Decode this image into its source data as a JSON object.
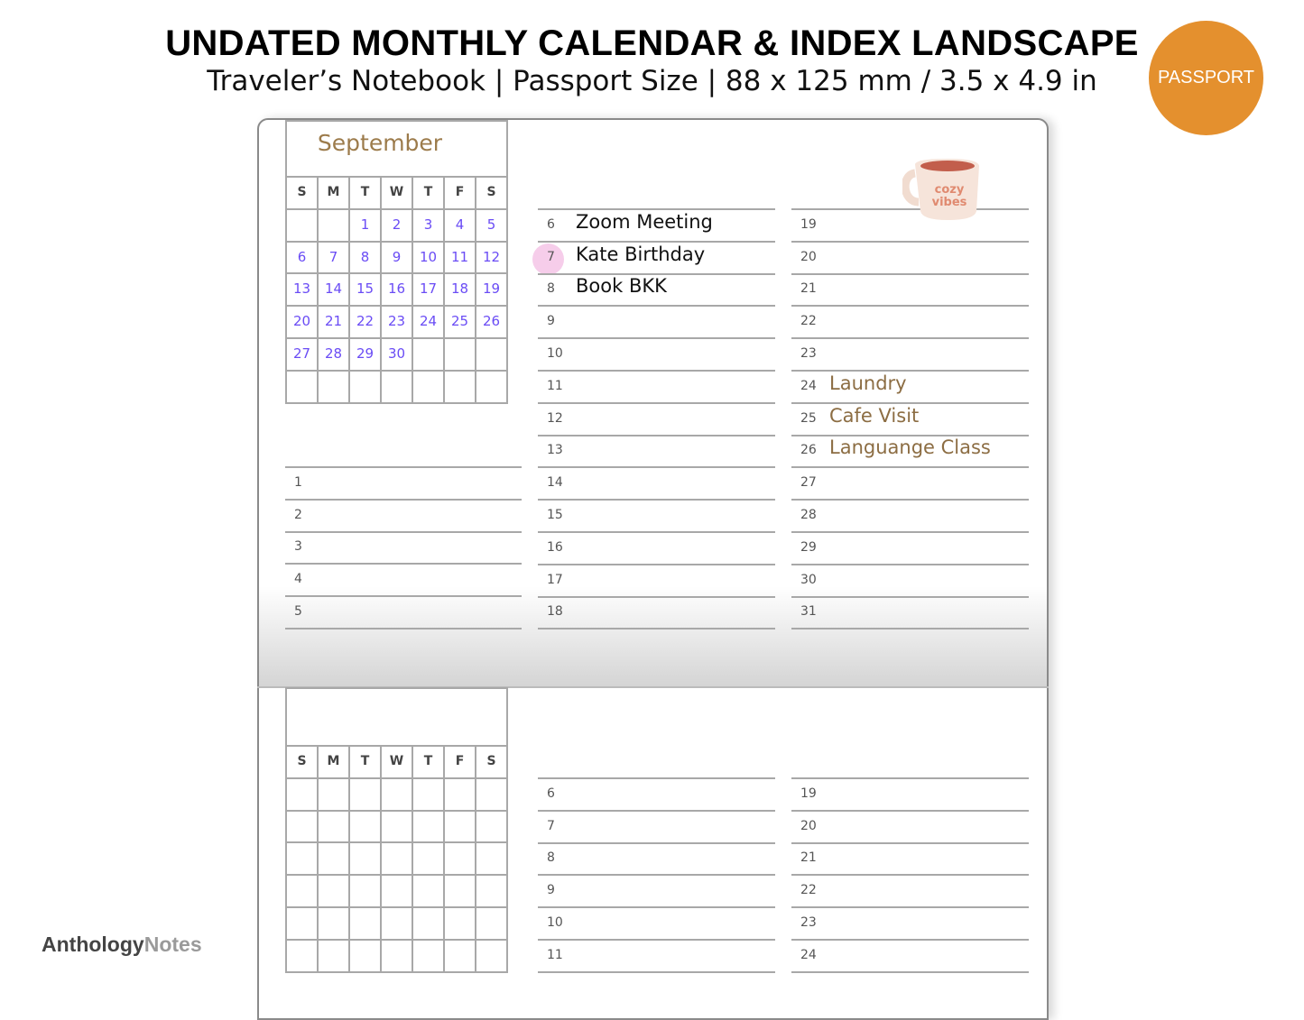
{
  "header": {
    "title": "UNDATED MONTHLY CALENDAR & INDEX LANDSCAPE",
    "subtitle": "Traveler’s Notebook | Passport Size | 88 x 125 mm / 3.5 x 4.9 in",
    "badge": "PASSPORT",
    "badge_color": "#e4902e"
  },
  "top_page": {
    "month": "September",
    "weekdays": [
      "S",
      "M",
      "T",
      "W",
      "T",
      "F",
      "S"
    ],
    "calendar_rows": [
      [
        "",
        "",
        "1",
        "2",
        "3",
        "4",
        "5"
      ],
      [
        "6",
        "7",
        "8",
        "9",
        "10",
        "11",
        "12"
      ],
      [
        "13",
        "14",
        "15",
        "16",
        "17",
        "18",
        "19"
      ],
      [
        "20",
        "21",
        "22",
        "23",
        "24",
        "25",
        "26"
      ],
      [
        "27",
        "28",
        "29",
        "30",
        "",
        "",
        ""
      ],
      [
        "",
        "",
        "",
        "",
        "",
        "",
        ""
      ]
    ],
    "left_list": [
      {
        "n": "1",
        "t": ""
      },
      {
        "n": "2",
        "t": ""
      },
      {
        "n": "3",
        "t": ""
      },
      {
        "n": "4",
        "t": ""
      },
      {
        "n": "5",
        "t": ""
      }
    ],
    "middle_list": [
      {
        "n": "6",
        "t": "Zoom Meeting"
      },
      {
        "n": "7",
        "t": "Kate Birthday"
      },
      {
        "n": "8",
        "t": "Book BKK"
      },
      {
        "n": "9",
        "t": ""
      },
      {
        "n": "10",
        "t": ""
      },
      {
        "n": "11",
        "t": ""
      },
      {
        "n": "12",
        "t": ""
      },
      {
        "n": "13",
        "t": ""
      },
      {
        "n": "14",
        "t": ""
      },
      {
        "n": "15",
        "t": ""
      },
      {
        "n": "16",
        "t": ""
      },
      {
        "n": "17",
        "t": ""
      },
      {
        "n": "18",
        "t": ""
      }
    ],
    "right_list": [
      {
        "n": "19",
        "t": ""
      },
      {
        "n": "20",
        "t": ""
      },
      {
        "n": "21",
        "t": ""
      },
      {
        "n": "22",
        "t": ""
      },
      {
        "n": "23",
        "t": ""
      },
      {
        "n": "24",
        "t": "Laundry"
      },
      {
        "n": "25",
        "t": "Cafe Visit"
      },
      {
        "n": "26",
        "t": "Languange Class"
      },
      {
        "n": "27",
        "t": ""
      },
      {
        "n": "28",
        "t": ""
      },
      {
        "n": "29",
        "t": ""
      },
      {
        "n": "30",
        "t": ""
      },
      {
        "n": "31",
        "t": ""
      }
    ],
    "highlighted_day": "7",
    "sticker_text": "cozy vibes"
  },
  "bottom_page": {
    "weekdays": [
      "S",
      "M",
      "T",
      "W",
      "T",
      "F",
      "S"
    ],
    "middle_list": [
      "6",
      "7",
      "8",
      "9",
      "10",
      "11"
    ],
    "right_list": [
      "19",
      "20",
      "21",
      "22",
      "23",
      "24"
    ]
  },
  "logo": {
    "part1": "Anthology",
    "part2": "Notes"
  }
}
